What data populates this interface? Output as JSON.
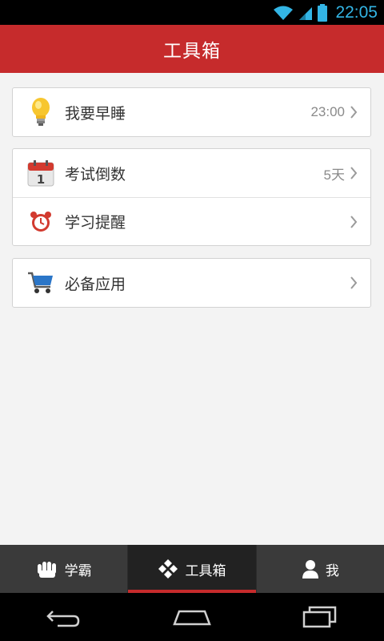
{
  "status_bar": {
    "time": "22:05"
  },
  "header": {
    "title": "工具箱"
  },
  "groups": [
    {
      "items": [
        {
          "label": "我要早睡",
          "value": "23:00",
          "icon": "lightbulb-icon"
        }
      ]
    },
    {
      "items": [
        {
          "label": "考试倒数",
          "value": "5天",
          "icon": "calendar-icon"
        },
        {
          "label": "学习提醒",
          "value": "",
          "icon": "alarm-clock-icon"
        }
      ]
    },
    {
      "items": [
        {
          "label": "必备应用",
          "value": "",
          "icon": "shopping-cart-icon"
        }
      ]
    }
  ],
  "bottom_nav": {
    "tabs": [
      {
        "label": "学霸",
        "icon": "fist-icon",
        "active": false
      },
      {
        "label": "工具箱",
        "icon": "diamond-grid-icon",
        "active": true
      },
      {
        "label": "我",
        "icon": "person-icon",
        "active": false
      }
    ]
  },
  "colors": {
    "brand": "#c62b2c",
    "status_time": "#33b5e5",
    "nav_bg": "#3a3a3a"
  }
}
